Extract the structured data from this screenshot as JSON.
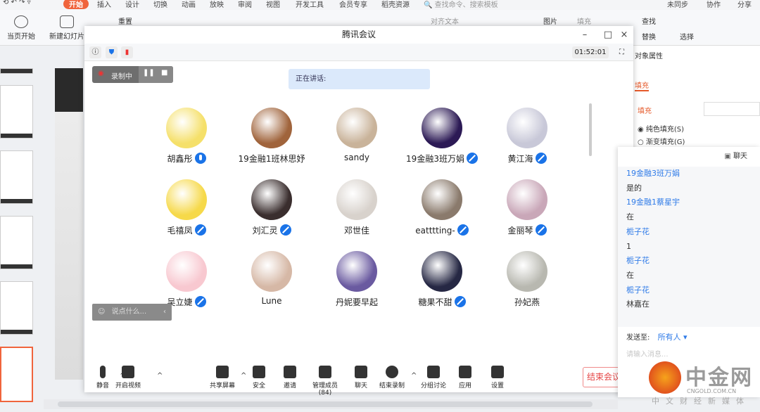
{
  "ribbon": {
    "tabs": [
      "开始",
      "插入",
      "设计",
      "切换",
      "动画",
      "放映",
      "审阅",
      "视图",
      "开发工具",
      "会员专享",
      "稻壳资源"
    ],
    "search_placeholder": "查找命令、搜索模板",
    "sync": "未同步",
    "collab": "协作",
    "share": "分享",
    "buttons": {
      "play": "当页开始",
      "new_slide": "新建幻灯片",
      "reset": "重置",
      "align_text": "对齐文本",
      "picture": "图片",
      "fill": "填充",
      "find": "查找",
      "replace": "替换",
      "select": "选择"
    }
  },
  "props": {
    "title": "对象属性",
    "tab": "填充",
    "fill_label": "填充",
    "solid": "纯色填充(S)",
    "gradient": "渐变填充(G)"
  },
  "meeting": {
    "title": "腾讯会议",
    "timer": "01:52:01",
    "recording": "录制中",
    "speaking": "正在讲话:",
    "say_placeholder": "说点什么...",
    "participants": [
      {
        "name": "胡鑫彤",
        "mic": "on",
        "color": "#f5e06a"
      },
      {
        "name": "19金融1班林思妤",
        "mic": "none",
        "color": "#a0643c"
      },
      {
        "name": "sandy",
        "mic": "none",
        "color": "#c9b39a"
      },
      {
        "name": "19金融3班万娟",
        "mic": "muted",
        "color": "#2c1a55"
      },
      {
        "name": "黄江海",
        "mic": "muted",
        "color": "#c8c8d8"
      },
      {
        "name": "毛禧凤",
        "mic": "muted",
        "color": "#f6d94a"
      },
      {
        "name": "刘汇灵",
        "mic": "muted",
        "color": "#3a2e2e"
      },
      {
        "name": "邓世佳",
        "mic": "none",
        "color": "#d8d2cc"
      },
      {
        "name": "eatttting-",
        "mic": "muted",
        "color": "#8a7a6c"
      },
      {
        "name": "金丽琴",
        "mic": "muted",
        "color": "#c9a7b8"
      },
      {
        "name": "吴立婕",
        "mic": "muted",
        "color": "#f8c8d0"
      },
      {
        "name": "Lune",
        "mic": "none",
        "color": "#d6b8a6"
      },
      {
        "name": "丹妮要早起",
        "mic": "none",
        "color": "#6a5aa0"
      },
      {
        "name": "糖果不甜",
        "mic": "muted",
        "color": "#262844"
      },
      {
        "name": "孙妃燕",
        "mic": "none",
        "color": "#b8b8b0"
      }
    ],
    "toolbar": [
      "静音",
      "开启视频",
      "共享屏幕",
      "安全",
      "邀请",
      "管理成员(84)",
      "聊天",
      "结束录制",
      "分组讨论",
      "应用",
      "设置"
    ],
    "end": "结束会议"
  },
  "chat": {
    "title": "聊天",
    "messages": [
      {
        "user": "19金融3班万娟",
        "text": "是的"
      },
      {
        "user": "19金融1蔡星宇",
        "text": "在"
      },
      {
        "user": "栀子花",
        "text": "1"
      },
      {
        "user": "栀子花",
        "text": "在"
      },
      {
        "user": "栀子花",
        "text": "林嘉在"
      }
    ],
    "send_to_label": "发送至:",
    "send_to": "所有人",
    "input_placeholder": "请输入消息..."
  },
  "watermark": {
    "name": "中金网",
    "domain": "CNGOLD.COM.CN",
    "slogan": "中文财经新媒体"
  }
}
